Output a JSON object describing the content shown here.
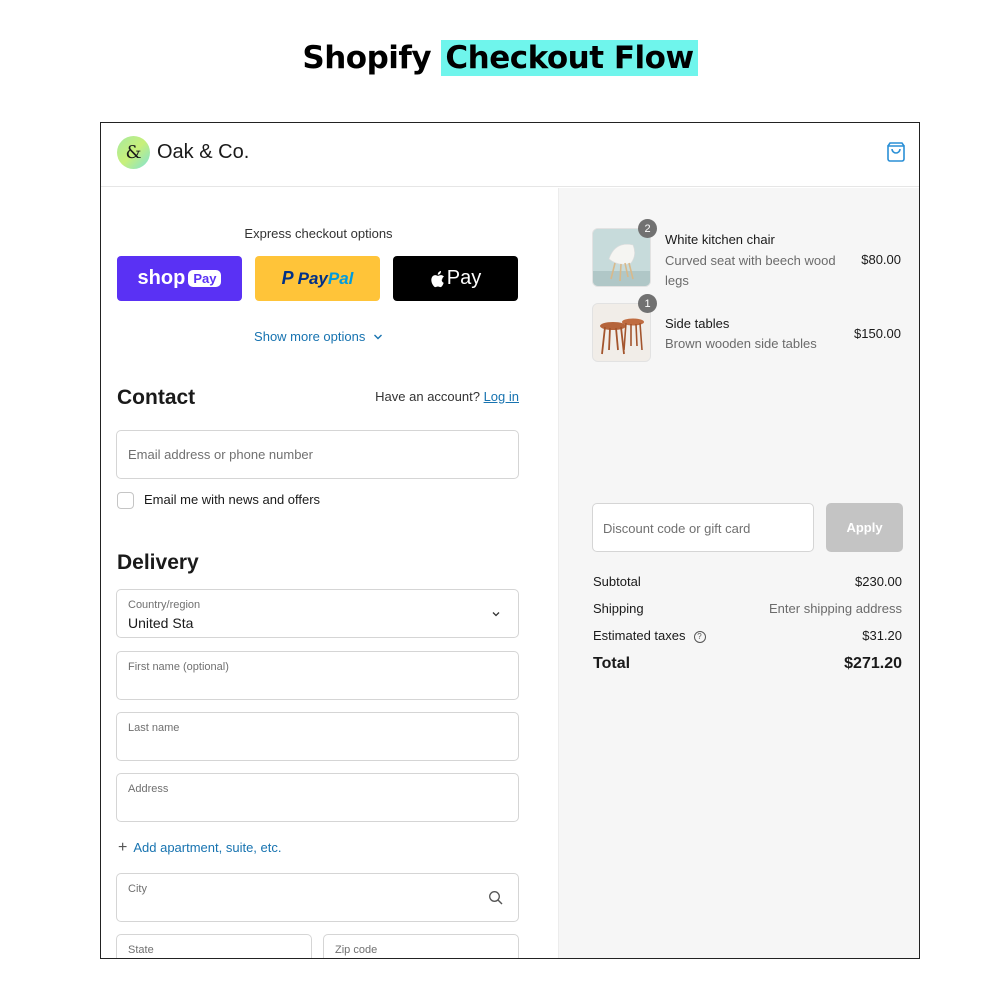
{
  "page": {
    "title_plain": "Shopify ",
    "title_highlight": "Checkout Flow"
  },
  "header": {
    "logo_glyph": "&",
    "brand_name": "Oak & Co.",
    "cart_icon": "shopping-bag-icon"
  },
  "express": {
    "label": "Express checkout options",
    "shop_pay": {
      "text": "shop",
      "pill": "Pay"
    },
    "paypal": {
      "mark": "P",
      "part1": "Pay",
      "part2": "Pal"
    },
    "apple_pay": {
      "logo": "",
      "text": "Pay"
    },
    "show_more": "Show more options"
  },
  "contact": {
    "title": "Contact",
    "have_account": "Have an account?",
    "login_label": "Log in",
    "email_placeholder": "Email address or phone number",
    "newsletter_label": "Email me with news and offers"
  },
  "delivery": {
    "title": "Delivery",
    "country_label": "Country/region",
    "country_value": "United Sta",
    "first_name_label": "First name (optional)",
    "last_name_label": "Last name",
    "address_label": "Address",
    "add_apartment": "Add apartment, suite, etc.",
    "city_label": "City",
    "state_label": "State",
    "zip_label": "Zip code"
  },
  "cart": {
    "items": [
      {
        "name": "White kitchen chair",
        "description": "Curved seat with beech wood legs",
        "price": "$80.00",
        "quantity": "2"
      },
      {
        "name": "Side tables",
        "description": "Brown wooden side tables",
        "price": "$150.00",
        "quantity": "1"
      }
    ],
    "discount_placeholder": "Discount code or gift card",
    "apply_label": "Apply",
    "subtotal_label": "Subtotal",
    "subtotal_value": "$230.00",
    "shipping_label": "Shipping",
    "shipping_value": "Enter shipping address",
    "taxes_label": "Estimated taxes",
    "taxes_value": "$31.20",
    "total_label": "Total",
    "total_value": "$271.20"
  },
  "colors": {
    "title_highlight": "#6ff5ec",
    "shop_pay": "#5a31f4",
    "paypal": "#ffc439",
    "apple_pay": "#000000",
    "link": "#1773b0",
    "apply_disabled": "#c4c4c4"
  }
}
